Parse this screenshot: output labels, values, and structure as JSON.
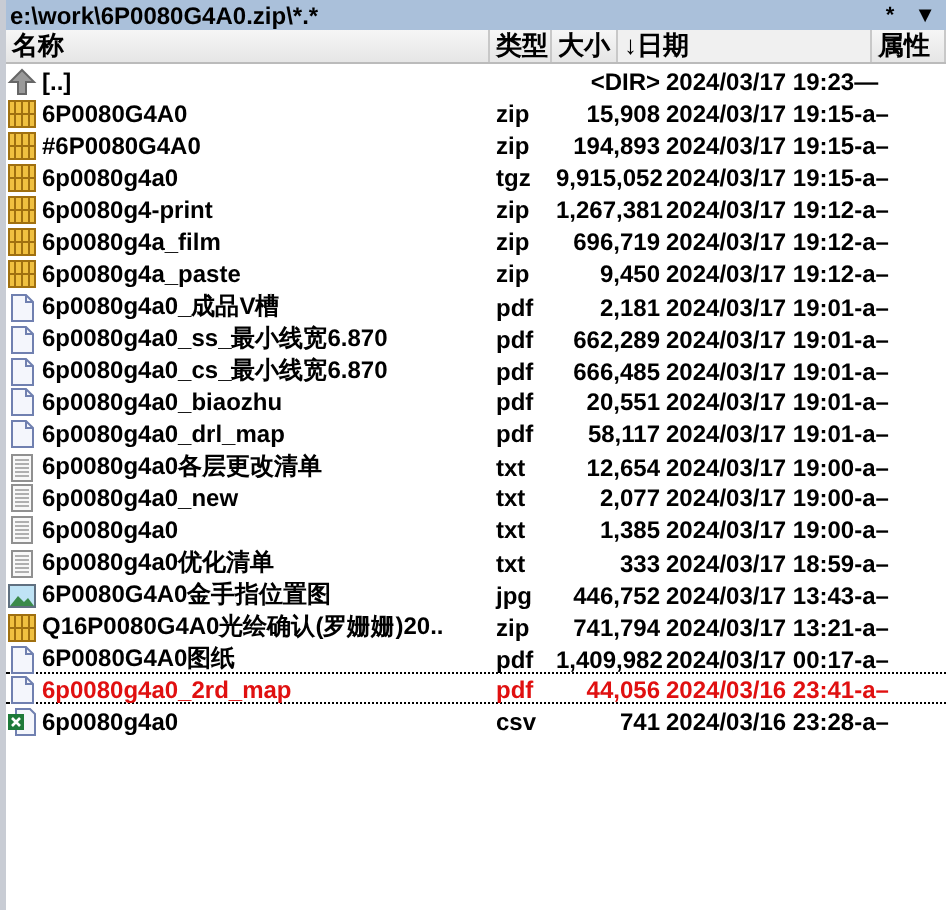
{
  "path_bar": {
    "path": "e:\\work\\6P0080G4A0.zip\\*.*",
    "buttons": [
      "*",
      "▼"
    ]
  },
  "columns": [
    "名称",
    "类型",
    "大小",
    "↓日期",
    "属性"
  ],
  "rows": [
    {
      "kind": "parent",
      "name": "[..]",
      "type": "",
      "size": "<DIR>",
      "date": "2024/03/17 19:23",
      "attr": "—",
      "selected": false,
      "focused": false
    },
    {
      "kind": "archive",
      "name": "6P0080G4A0",
      "type": "zip",
      "size": "15,908",
      "date": "2024/03/17 19:15",
      "attr": "-a–",
      "selected": false,
      "focused": false
    },
    {
      "kind": "archive",
      "name": "#6P0080G4A0",
      "type": "zip",
      "size": "194,893",
      "date": "2024/03/17 19:15",
      "attr": "-a–",
      "selected": false,
      "focused": false
    },
    {
      "kind": "archive",
      "name": "6p0080g4a0",
      "type": "tgz",
      "size": "9,915,052",
      "date": "2024/03/17 19:15",
      "attr": "-a–",
      "selected": false,
      "focused": false
    },
    {
      "kind": "archive",
      "name": "6p0080g4-print",
      "type": "zip",
      "size": "1,267,381",
      "date": "2024/03/17 19:12",
      "attr": "-a–",
      "selected": false,
      "focused": false
    },
    {
      "kind": "archive",
      "name": "6p0080g4a_film",
      "type": "zip",
      "size": "696,719",
      "date": "2024/03/17 19:12",
      "attr": "-a–",
      "selected": false,
      "focused": false
    },
    {
      "kind": "archive",
      "name": "6p0080g4a_paste",
      "type": "zip",
      "size": "9,450",
      "date": "2024/03/17 19:12",
      "attr": "-a–",
      "selected": false,
      "focused": false
    },
    {
      "kind": "document",
      "name": "6p0080g4a0_成品V槽",
      "type": "pdf",
      "size": "2,181",
      "date": "2024/03/17 19:01",
      "attr": "-a–",
      "selected": false,
      "focused": false
    },
    {
      "kind": "document",
      "name": "6p0080g4a0_ss_最小线宽6.870",
      "type": "pdf",
      "size": "662,289",
      "date": "2024/03/17 19:01",
      "attr": "-a–",
      "selected": false,
      "focused": false
    },
    {
      "kind": "document",
      "name": "6p0080g4a0_cs_最小线宽6.870",
      "type": "pdf",
      "size": "666,485",
      "date": "2024/03/17 19:01",
      "attr": "-a–",
      "selected": false,
      "focused": false
    },
    {
      "kind": "document",
      "name": "6p0080g4a0_biaozhu",
      "type": "pdf",
      "size": "20,551",
      "date": "2024/03/17 19:01",
      "attr": "-a–",
      "selected": false,
      "focused": false
    },
    {
      "kind": "document",
      "name": "6p0080g4a0_drl_map",
      "type": "pdf",
      "size": "58,117",
      "date": "2024/03/17 19:01",
      "attr": "-a–",
      "selected": false,
      "focused": false
    },
    {
      "kind": "text",
      "name": "6p0080g4a0各层更改清单",
      "type": "txt",
      "size": "12,654",
      "date": "2024/03/17 19:00",
      "attr": "-a–",
      "selected": false,
      "focused": false
    },
    {
      "kind": "text",
      "name": "6p0080g4a0_new",
      "type": "txt",
      "size": "2,077",
      "date": "2024/03/17 19:00",
      "attr": "-a–",
      "selected": false,
      "focused": false
    },
    {
      "kind": "text",
      "name": "6p0080g4a0",
      "type": "txt",
      "size": "1,385",
      "date": "2024/03/17 19:00",
      "attr": "-a–",
      "selected": false,
      "focused": false
    },
    {
      "kind": "text",
      "name": "6p0080g4a0优化清单",
      "type": "txt",
      "size": "333",
      "date": "2024/03/17 18:59",
      "attr": "-a–",
      "selected": false,
      "focused": false
    },
    {
      "kind": "image",
      "name": "6P0080G4A0金手指位置图",
      "type": "jpg",
      "size": "446,752",
      "date": "2024/03/17 13:43",
      "attr": "-a–",
      "selected": false,
      "focused": false
    },
    {
      "kind": "archive",
      "name": "Q16P0080G4A0光绘确认(罗姗姗)20..",
      "type": "zip",
      "size": "741,794",
      "date": "2024/03/17 13:21",
      "attr": "-a–",
      "selected": false,
      "focused": false
    },
    {
      "kind": "document",
      "name": "6P0080G4A0图纸",
      "type": "pdf",
      "size": "1,409,982",
      "date": "2024/03/17 00:17",
      "attr": "-a–",
      "selected": false,
      "focused": false
    },
    {
      "kind": "document",
      "name": "6p0080g4a0_2rd_map",
      "type": "pdf",
      "size": "44,056",
      "date": "2024/03/16 23:41",
      "attr": "-a–",
      "selected": true,
      "focused": true
    },
    {
      "kind": "spreadsheet",
      "name": "6p0080g4a0",
      "type": "csv",
      "size": "741",
      "date": "2024/03/16 23:28",
      "attr": "-a–",
      "selected": false,
      "focused": false
    }
  ]
}
